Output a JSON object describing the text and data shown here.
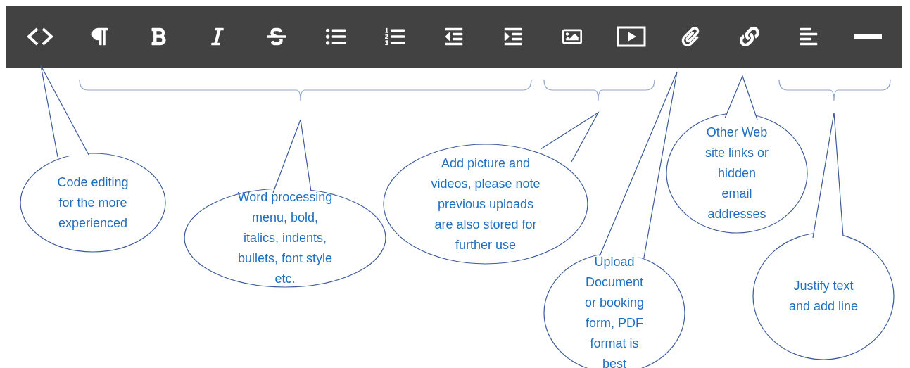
{
  "callouts": [
    {
      "lines": [
        "Code editing",
        "for the more",
        "experienced"
      ]
    },
    {
      "lines": [
        "Word processing",
        "menu, bold,",
        "italics, indents,",
        "bullets, font style",
        "etc."
      ]
    },
    {
      "lines": [
        "Add picture and",
        "videos, please note",
        "previous uploads",
        "are also stored for",
        "further use"
      ]
    },
    {
      "lines": [
        "Upload",
        "Document",
        "or booking",
        "form, PDF",
        "format is",
        "best"
      ]
    },
    {
      "lines": [
        "Other Web",
        "site links or",
        "hidden",
        "email",
        "addresses"
      ]
    },
    {
      "lines": [
        "Justify text",
        "and add line"
      ]
    }
  ]
}
